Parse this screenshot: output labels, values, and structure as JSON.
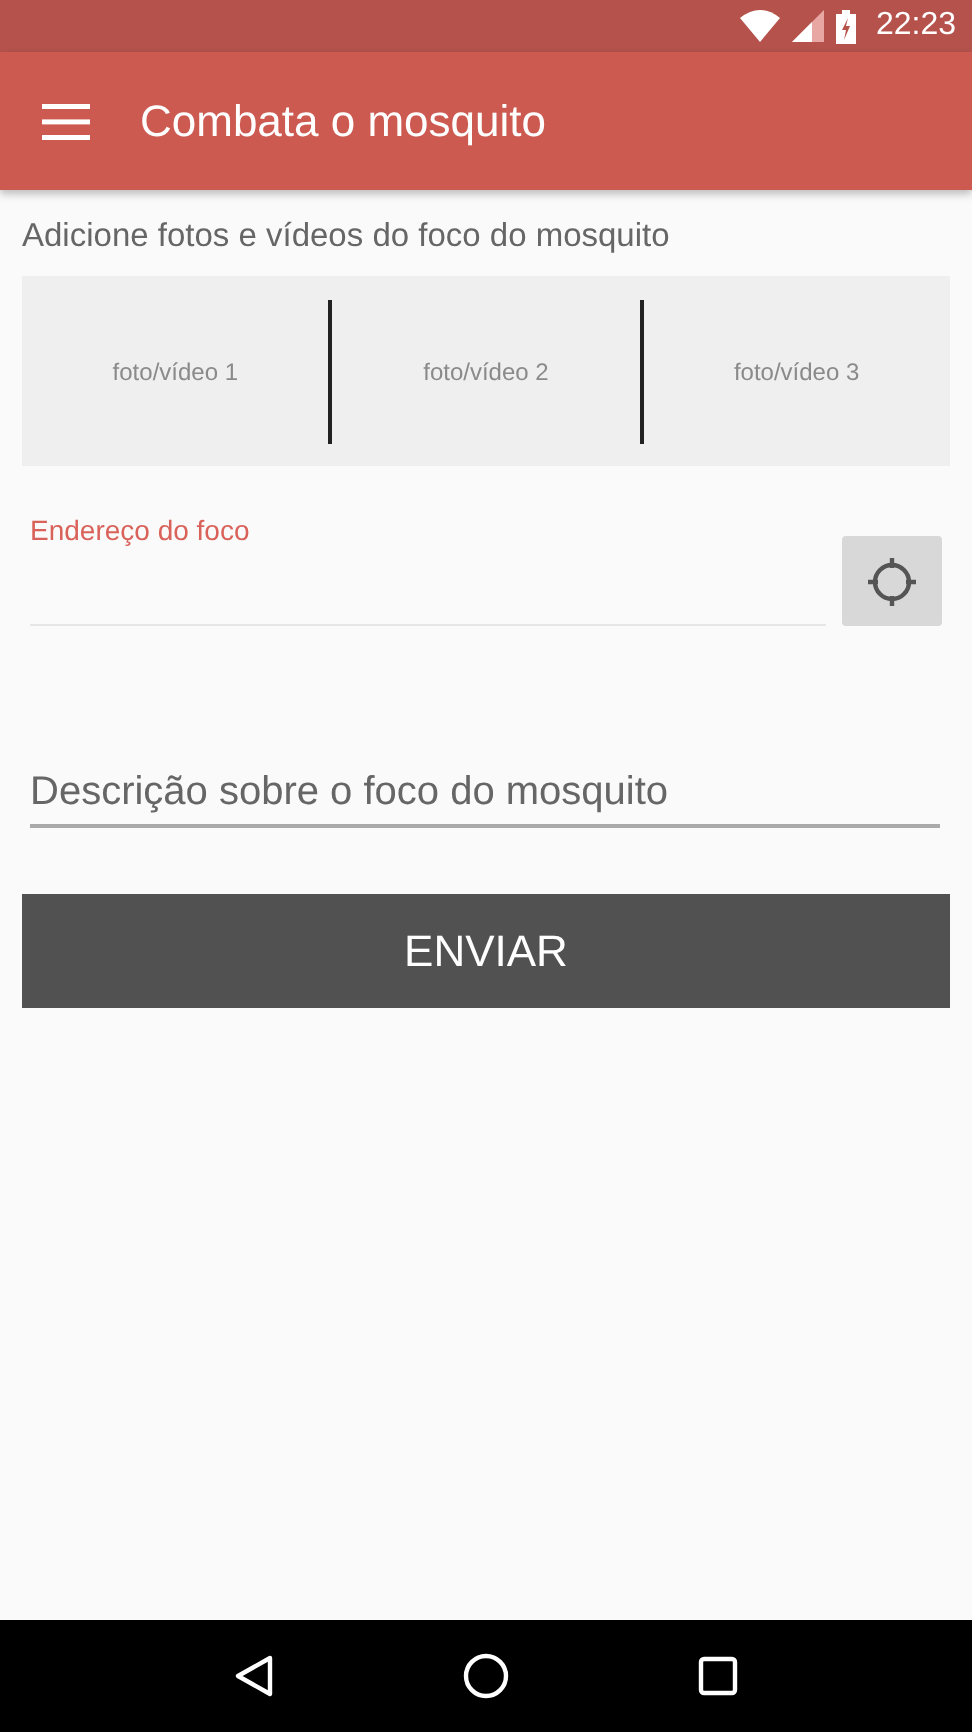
{
  "status_bar": {
    "time": "22:23"
  },
  "app_bar": {
    "title": "Combata o mosquito"
  },
  "media": {
    "heading": "Adicione fotos e vídeos do foco do mosquito",
    "slots": [
      "foto/vídeo 1",
      "foto/vídeo 2",
      "foto/vídeo 3"
    ]
  },
  "address": {
    "label": "Endereço do foco",
    "focused": true
  },
  "description": {
    "placeholder": "Descrição sobre o foco do mosquito"
  },
  "submit": {
    "label": "ENVIAR"
  }
}
